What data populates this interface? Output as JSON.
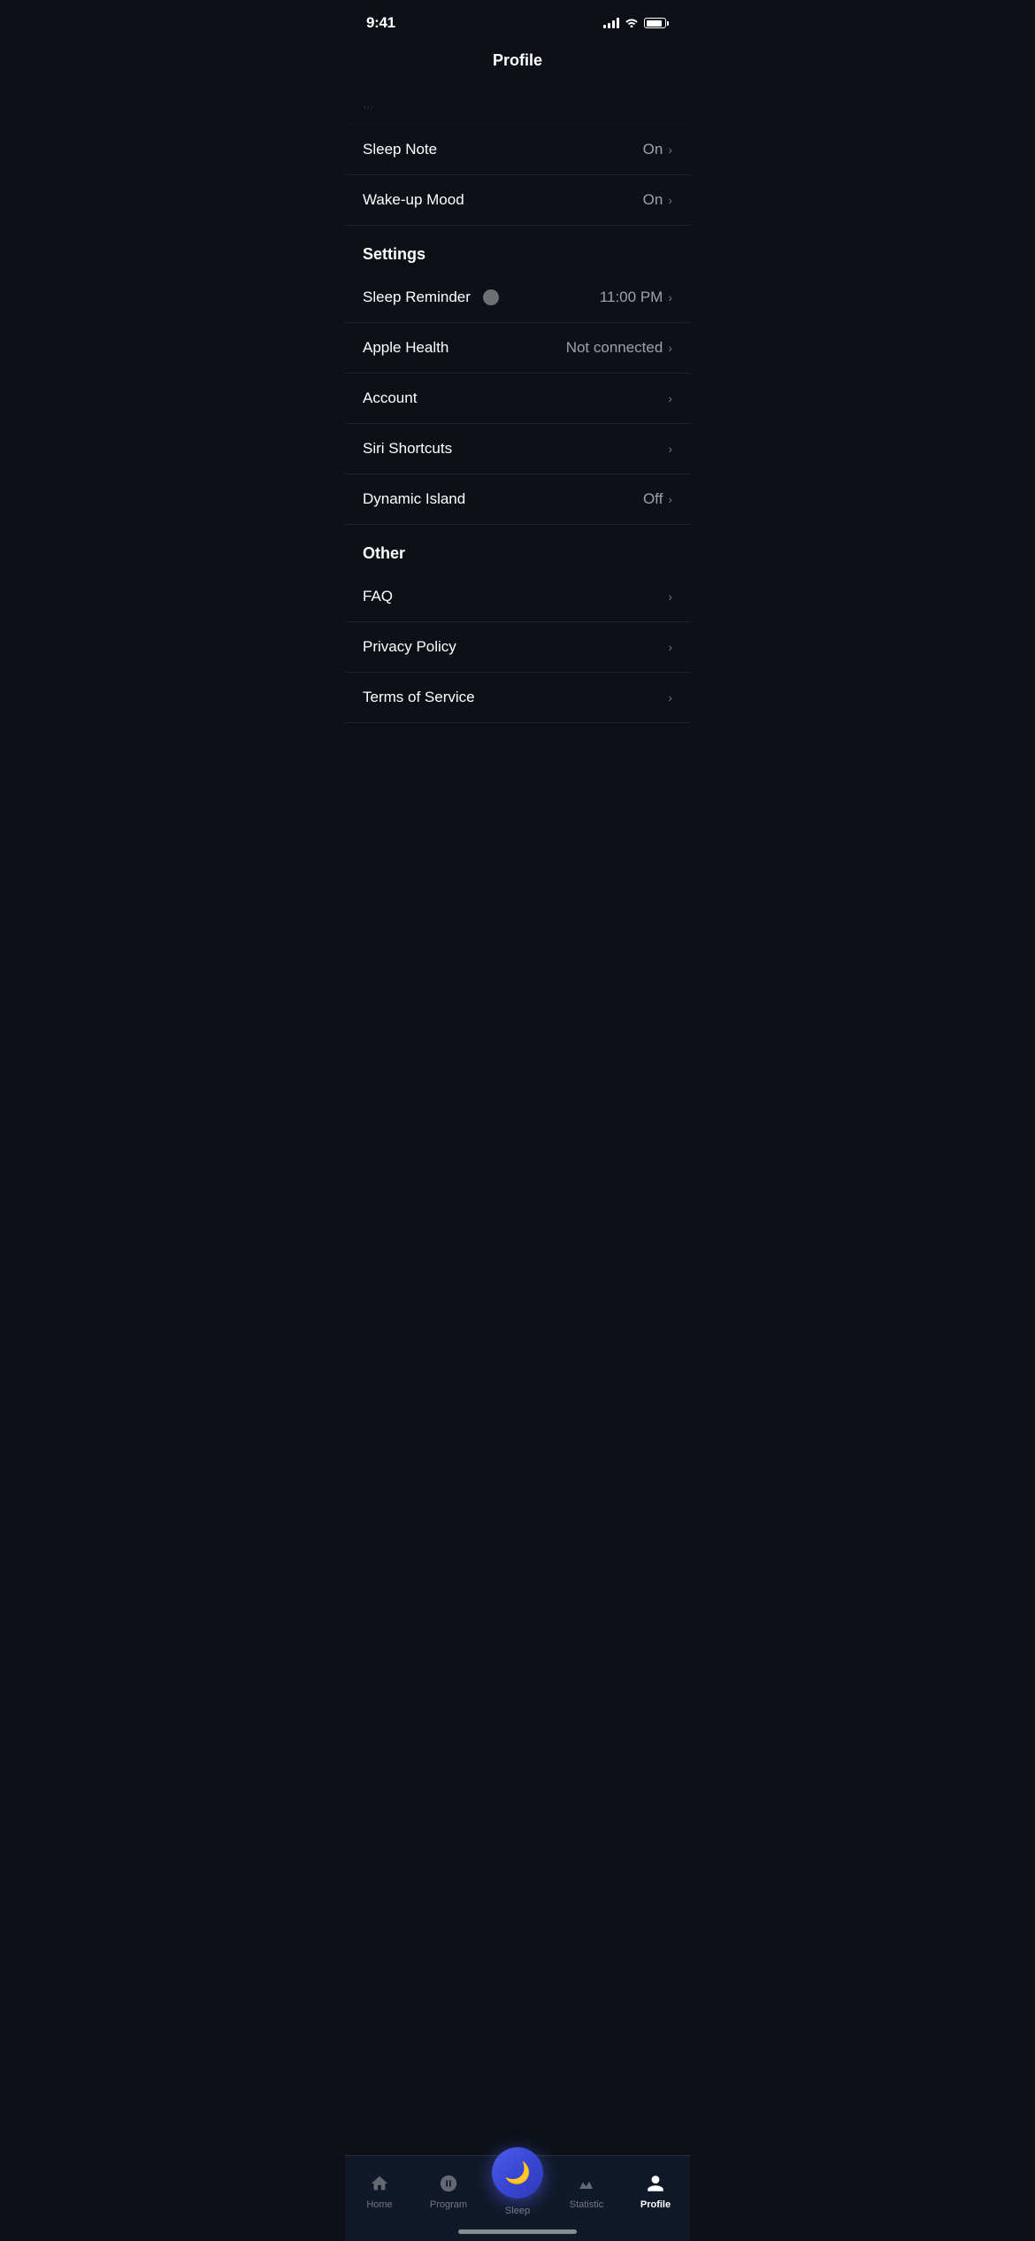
{
  "statusBar": {
    "time": "9:41"
  },
  "header": {
    "title": "Profile"
  },
  "partialRow": {
    "label": "..."
  },
  "rows": [
    {
      "id": "sleep-note",
      "label": "Sleep Note",
      "value": "On",
      "hasChevron": true
    },
    {
      "id": "wakeup-mood",
      "label": "Wake-up Mood",
      "value": "On",
      "hasChevron": true
    }
  ],
  "settings": {
    "sectionLabel": "Settings",
    "items": [
      {
        "id": "sleep-reminder",
        "label": "Sleep Reminder",
        "value": "11:00 PM",
        "hasChevron": true,
        "hasToggle": true
      },
      {
        "id": "apple-health",
        "label": "Apple Health",
        "value": "Not connected",
        "hasChevron": true
      },
      {
        "id": "account",
        "label": "Account",
        "value": "",
        "hasChevron": true
      },
      {
        "id": "siri-shortcuts",
        "label": "Siri Shortcuts",
        "value": "",
        "hasChevron": true
      },
      {
        "id": "dynamic-island",
        "label": "Dynamic Island",
        "value": "Off",
        "hasChevron": true
      }
    ]
  },
  "other": {
    "sectionLabel": "Other",
    "items": [
      {
        "id": "faq",
        "label": "FAQ",
        "hasChevron": true
      },
      {
        "id": "privacy-policy",
        "label": "Privacy Policy",
        "hasChevron": true
      },
      {
        "id": "terms-of-service",
        "label": "Terms of Service",
        "hasChevron": true
      }
    ]
  },
  "tabBar": {
    "items": [
      {
        "id": "home",
        "label": "Home",
        "active": false
      },
      {
        "id": "program",
        "label": "Program",
        "active": false
      },
      {
        "id": "sleep",
        "label": "Sleep",
        "active": false,
        "isCentral": true
      },
      {
        "id": "statistic",
        "label": "Statistic",
        "active": false
      },
      {
        "id": "profile",
        "label": "Profile",
        "active": true
      }
    ]
  }
}
